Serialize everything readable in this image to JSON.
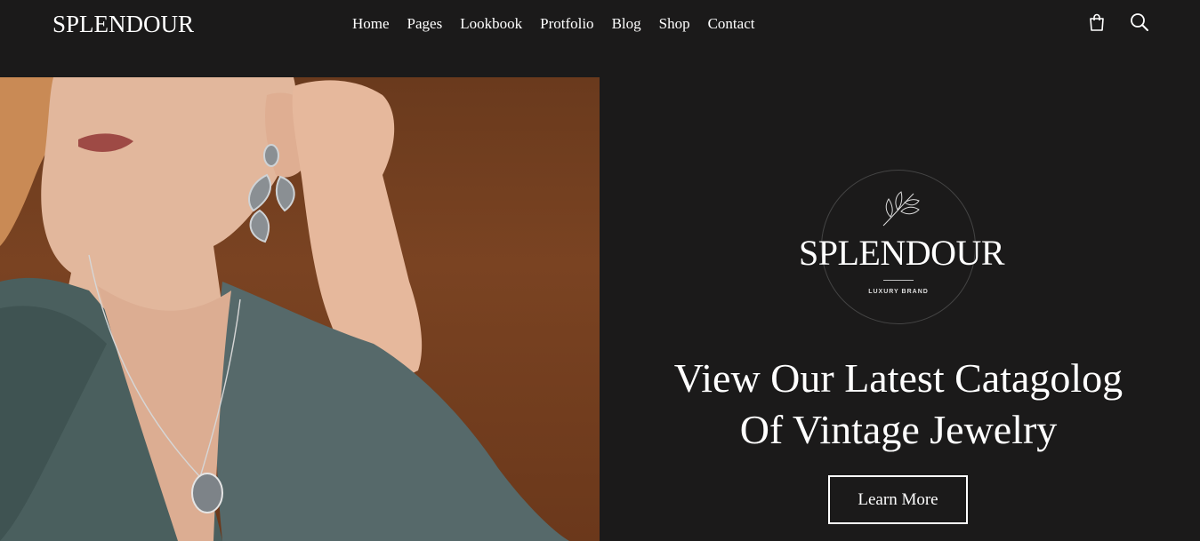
{
  "brand": {
    "logo": "SPLENDOUR"
  },
  "nav": {
    "items": [
      {
        "label": "Home"
      },
      {
        "label": "Pages"
      },
      {
        "label": "Lookbook"
      },
      {
        "label": "Protfolio"
      },
      {
        "label": "Blog"
      },
      {
        "label": "Shop"
      },
      {
        "label": "Contact"
      }
    ]
  },
  "header_icons": [
    "shopping-bag-icon",
    "search-icon"
  ],
  "hero": {
    "badge_name": "SPLENDOUR",
    "badge_tagline": "LUXURY BRAND",
    "headline_line1": "View Our Latest Catagolog",
    "headline_line2": "Of Vintage Jewelry",
    "cta_label": "Learn More"
  },
  "colors": {
    "background": "#1b1a1a",
    "photo_backdrop": "#6f3d1f",
    "text": "#ffffff"
  }
}
